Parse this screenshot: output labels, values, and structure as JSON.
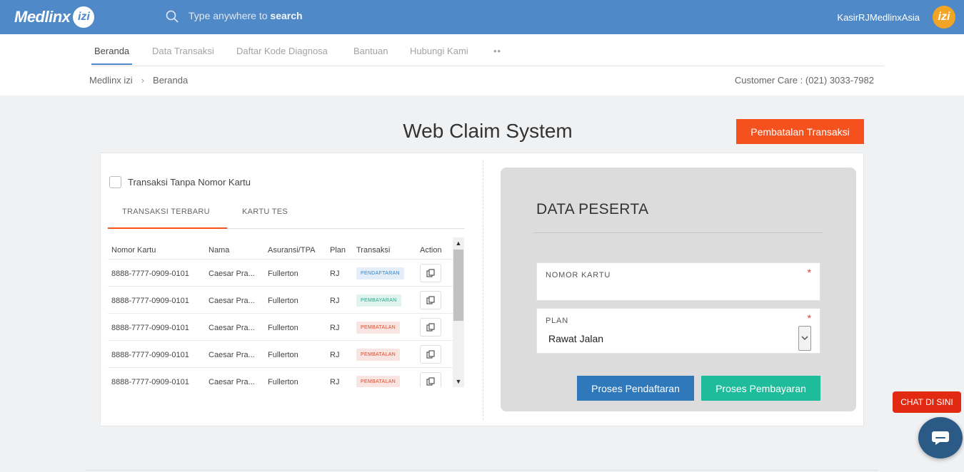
{
  "header": {
    "logo_text": "Medlinx",
    "logo_badge": "izi",
    "search_placeholder_prefix": "Type anywhere to",
    "search_placeholder_bold": "search",
    "user_name": "KasirRJMedlinxAsia",
    "avatar_text": "izi"
  },
  "nav": {
    "items": [
      "Beranda",
      "Data Transaksi",
      "Daftar Kode Diagnosa",
      "Bantuan",
      "Hubungi Kami"
    ],
    "more": "••"
  },
  "breadcrumb": {
    "root": "Medlinx izi",
    "separator": "›",
    "current": "Beranda"
  },
  "customer_care": "Customer Care : (021) 3033-7982",
  "page": {
    "title": "Web Claim System",
    "cancel_button": "Pembatalan Transaksi"
  },
  "left_panel": {
    "checkbox_label": "Transaksi Tanpa Nomor Kartu",
    "checkbox_checked": false,
    "tabs": [
      "TRANSAKSI TERBARU",
      "KARTU TES"
    ],
    "active_tab": "TRANSAKSI TERBARU",
    "table": {
      "headers": [
        "Nomor Kartu",
        "Nama",
        "Asuransi/TPA",
        "Plan",
        "Transaksi",
        "Action"
      ],
      "rows": [
        {
          "nomor": "8888-7777-0909-0101",
          "nama": "Caesar Pra...",
          "asuransi": "Fullerton",
          "plan": "RJ",
          "transaksi": "PENDAFTARAN"
        },
        {
          "nomor": "8888-7777-0909-0101",
          "nama": "Caesar Pra...",
          "asuransi": "Fullerton",
          "plan": "RJ",
          "transaksi": "PEMBAYARAN"
        },
        {
          "nomor": "8888-7777-0909-0101",
          "nama": "Caesar Pra...",
          "asuransi": "Fullerton",
          "plan": "RJ",
          "transaksi": "PEMBATALAN"
        },
        {
          "nomor": "8888-7777-0909-0101",
          "nama": "Caesar Pra...",
          "asuransi": "Fullerton",
          "plan": "RJ",
          "transaksi": "PEMBATALAN"
        },
        {
          "nomor": "8888-7777-0909-0101",
          "nama": "Caesar Pra...",
          "asuransi": "Fullerton",
          "plan": "RJ",
          "transaksi": "PEMBATALAN"
        }
      ]
    },
    "badge_colors": {
      "PENDAFTARAN": {
        "text": "#2f86d1",
        "bg": "#e3eef8"
      },
      "PEMBAYARAN": {
        "text": "#1fa989",
        "bg": "#e0f3ee"
      },
      "PEMBATALAN": {
        "text": "#e0482a",
        "bg": "#f8e4e0"
      }
    }
  },
  "right_panel": {
    "title": "DATA PESERTA",
    "nomor_kartu_label": "NOMOR KARTU",
    "nomor_kartu_value": "",
    "plan_label": "PLAN",
    "plan_value": "Rawat Jalan",
    "required_mark": "*",
    "btn_pendaftaran": "Proses Pendaftaran",
    "btn_pembayaran": "Proses Pembayaran"
  },
  "chat": {
    "label": "CHAT DI SINI"
  },
  "colors": {
    "header_bg": "#4f89c8",
    "accent_orange": "#f4511e",
    "primary_blue": "#2f78b9",
    "success_teal": "#1fbc9c"
  }
}
